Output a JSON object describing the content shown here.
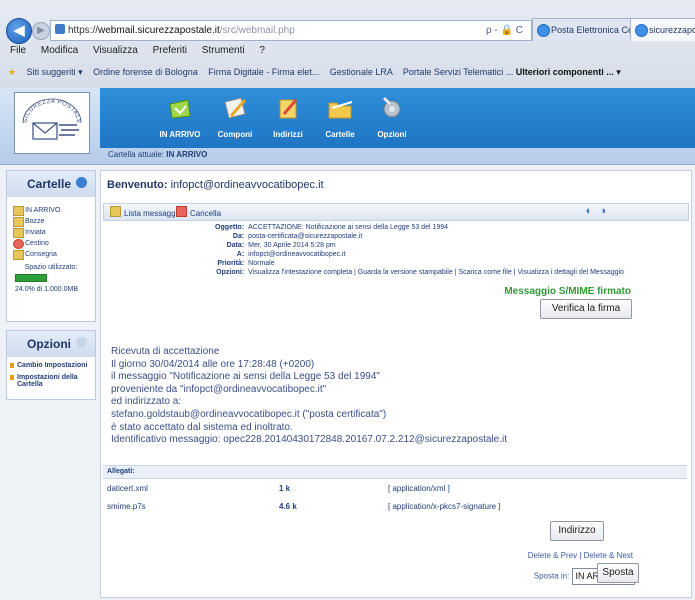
{
  "browser": {
    "url_proto": "https://",
    "url_host": "webmail.sicurezzapostale.it",
    "url_path": "/src/webmail.php",
    "url_tools": "ρ - 🔒 C",
    "tabs": [
      "Posta Elettronica Certificata",
      "sicurezzapostale"
    ],
    "menu": [
      "File",
      "Modifica",
      "Visualizza",
      "Preferiti",
      "Strumenti",
      "?"
    ],
    "favorites": [
      "Siti suggeriti ▾",
      "Ordine forense di Bologna",
      "Firma Digitale - Firma elet...",
      "Gestionale LRA",
      "Portale Servizi Telematici ...",
      "Ulteriori componenti ... ▾"
    ]
  },
  "header": {
    "logo_text": "SICUREZZA POSTALE",
    "toolbar": [
      {
        "label": "IN ARRIVO",
        "icon": "inbox-icon"
      },
      {
        "label": "Componi",
        "icon": "compose-icon"
      },
      {
        "label": "Indirizzi",
        "icon": "address-book-icon"
      },
      {
        "label": "Cartelle",
        "icon": "folders-icon"
      },
      {
        "label": "Opzioni",
        "icon": "options-gear-icon"
      }
    ],
    "current_folder_label": "Cartella attuale:",
    "current_folder": "IN ARRIVO"
  },
  "sidebar": {
    "folders_title": "Cartelle",
    "folders": [
      "IN ARRIVO",
      "Bozze",
      "Inviata",
      "Cestino",
      "Consegna"
    ],
    "space_label": "Spazio utilizzato:",
    "space_value": "24.0% di 1.000.0MB",
    "space_used_fraction": 0.24,
    "options_title": "Opzioni",
    "options": [
      "Cambio Impostazioni",
      "Impostazioni della Cartella"
    ]
  },
  "main": {
    "welcome_label": "Benvenuto:",
    "welcome_user": "infopct@ordineavvocatibopec.it",
    "msg_toolbar": {
      "list": "Lista messaggi",
      "delete": "Cancella",
      "nav": "◐ ◑"
    },
    "headers": [
      {
        "k": "Oggetto:",
        "v": "ACCETTAZIONE: Notificazione ai sensi della Legge 53 del 1994"
      },
      {
        "k": "Da:",
        "v": "posta-certificata@sicurezzapostale.it"
      },
      {
        "k": "Data:",
        "v": "Mer, 30 Aprile 2014 5:28 pm"
      },
      {
        "k": "A:",
        "v": "infopct@ordineavvocatibopec.it"
      },
      {
        "k": "Priorità:",
        "v": "Normale"
      },
      {
        "k": "Opzioni:",
        "v": "Visualizza l'intestazione completa | Guarda la versione stampabile | Scarica come file | Visualizza i dettagli del Messaggio"
      }
    ],
    "smime_label": "Messaggio S/MIME firmato",
    "verify_button": "Verifica la firma",
    "body": [
      "Ricevuta di accettazione",
      "Il giorno 30/04/2014 alle ore 17:28:48 (+0200)",
      "il messaggio \"Notificazione ai sensi della Legge 53 del 1994\"",
      "proveniente da \"infopct@ordineavvocatibopec.it\"",
      "ed indirizzato a:",
      "stefano.goldstaub@ordineavvocatibopec.it (\"posta certificata\")",
      "è stato accettato dal sistema ed inoltrato.",
      "Identificativo messaggio: opec228.20140430172848.20167.07.2.212@sicurezzapostale.it"
    ],
    "attachments_title": "Allegati:",
    "attachments": [
      {
        "name": "daticert.xml",
        "size": "1 k",
        "type": "[ application/xml ]"
      },
      {
        "name": "smime.p7s",
        "size": "4.6 k",
        "type": "[ application/x-pkcs7-signature ]"
      }
    ],
    "address_button": "Indirizzo",
    "delete_links": "Delete & Prev  |  Delete & Next",
    "move_label": "Sposta in:",
    "move_select": "IN ARRIVO",
    "move_button": "Sposta"
  }
}
